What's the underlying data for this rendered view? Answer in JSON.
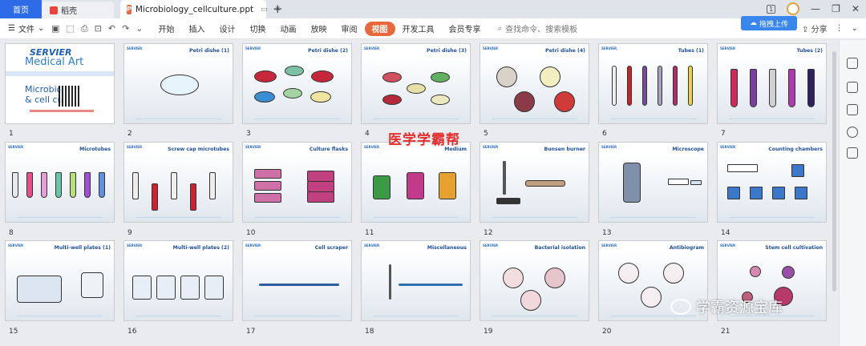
{
  "tabs": {
    "home": "首页",
    "docer": "稻壳",
    "file": "Microbiology_cellculture.ppt"
  },
  "window": {
    "page_badge": "1"
  },
  "toolbar": {
    "file_menu": "文件",
    "items": [
      "开始",
      "插入",
      "设计",
      "切换",
      "动画",
      "放映",
      "审阅",
      "视图",
      "开发工具",
      "会员专享"
    ],
    "active": "视图",
    "search_placeholder": "查找命令、搜索模板",
    "share": "分享",
    "drag_upload": "拖拽上传"
  },
  "cover": {
    "brand_line1": "SERVIER",
    "brand_line2": "Medical Art",
    "title": "Microbio\n& cell cu"
  },
  "slides": [
    {
      "num": "1",
      "title": ""
    },
    {
      "num": "2",
      "title": "Petri dishe (1)"
    },
    {
      "num": "3",
      "title": "Petri dishe (2)"
    },
    {
      "num": "4",
      "title": "Petri dishe (3)"
    },
    {
      "num": "5",
      "title": "Petri dishe (4)"
    },
    {
      "num": "6",
      "title": "Tubes (1)"
    },
    {
      "num": "7",
      "title": "Tubes (2)"
    },
    {
      "num": "8",
      "title": "Microtubes"
    },
    {
      "num": "9",
      "title": "Screw cap microtubes"
    },
    {
      "num": "10",
      "title": "Culture flasks"
    },
    {
      "num": "11",
      "title": "Medium"
    },
    {
      "num": "12",
      "title": "Bunsen burner"
    },
    {
      "num": "13",
      "title": "Microscope"
    },
    {
      "num": "14",
      "title": "Counting chambers"
    },
    {
      "num": "15",
      "title": "Multi-well plates (1)"
    },
    {
      "num": "16",
      "title": "Multi-well plates (2)"
    },
    {
      "num": "17",
      "title": "Cell scraper"
    },
    {
      "num": "18",
      "title": "Miscellaneous"
    },
    {
      "num": "19",
      "title": "Bacterial isolation"
    },
    {
      "num": "20",
      "title": "Antibiogram"
    },
    {
      "num": "21",
      "title": "Stem cell cultivation"
    }
  ],
  "slide_brand": "SERVIER",
  "watermarks": {
    "red": "医学学霸帮",
    "wechat": "学霸资源宝库"
  }
}
